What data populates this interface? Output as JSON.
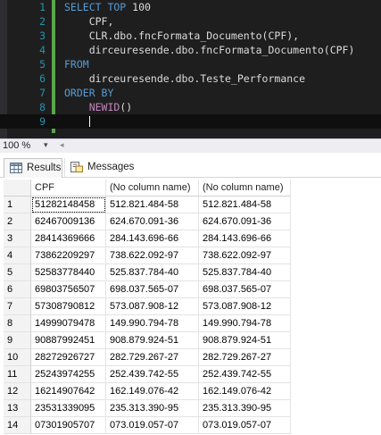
{
  "editor": {
    "lines": [
      {
        "num": "1",
        "parts": [
          {
            "t": "SELECT TOP ",
            "c": "kw"
          },
          {
            "t": "100",
            "c": ""
          }
        ]
      },
      {
        "num": "2",
        "parts": [
          {
            "t": "    CPF,",
            "c": ""
          }
        ]
      },
      {
        "num": "3",
        "parts": [
          {
            "t": "    CLR.dbo.fncFormata_Documento(CPF),",
            "c": ""
          }
        ]
      },
      {
        "num": "4",
        "parts": [
          {
            "t": "    dirceuresende.dbo.fncFormata_Documento(CPF)",
            "c": ""
          }
        ]
      },
      {
        "num": "5",
        "parts": [
          {
            "t": "FROM",
            "c": "kw"
          }
        ]
      },
      {
        "num": "6",
        "parts": [
          {
            "t": "    dirceuresende.dbo.Teste_Performance",
            "c": ""
          }
        ]
      },
      {
        "num": "7",
        "parts": [
          {
            "t": "ORDER BY",
            "c": "kw"
          }
        ]
      },
      {
        "num": "8",
        "parts": [
          {
            "t": "    ",
            "c": ""
          },
          {
            "t": "NEWID",
            "c": "fn"
          },
          {
            "t": "()",
            "c": ""
          }
        ]
      },
      {
        "num": "9",
        "parts": [
          {
            "t": "",
            "c": ""
          }
        ]
      }
    ]
  },
  "status": {
    "zoom": "100 %",
    "zoom_arrow": "▾",
    "scroll_arrow": "◂"
  },
  "tabs": {
    "results_label": "Results",
    "messages_label": "Messages"
  },
  "grid": {
    "columns": [
      "CPF",
      "(No column name)",
      "(No column name)"
    ],
    "rows": [
      [
        "1",
        "51282148458",
        "512.821.484-58",
        "512.821.484-58"
      ],
      [
        "2",
        "62467009136",
        "624.670.091-36",
        "624.670.091-36"
      ],
      [
        "3",
        "28414369666",
        "284.143.696-66",
        "284.143.696-66"
      ],
      [
        "4",
        "73862209297",
        "738.622.092-97",
        "738.622.092-97"
      ],
      [
        "5",
        "52583778440",
        "525.837.784-40",
        "525.837.784-40"
      ],
      [
        "6",
        "69803756507",
        "698.037.565-07",
        "698.037.565-07"
      ],
      [
        "7",
        "57308790812",
        "573.087.908-12",
        "573.087.908-12"
      ],
      [
        "8",
        "14999079478",
        "149.990.794-78",
        "149.990.794-78"
      ],
      [
        "9",
        "90887992451",
        "908.879.924-51",
        "908.879.924-51"
      ],
      [
        "10",
        "28272926727",
        "282.729.267-27",
        "282.729.267-27"
      ],
      [
        "11",
        "25243974255",
        "252.439.742-55",
        "252.439.742-55"
      ],
      [
        "12",
        "16214907642",
        "162.149.076-42",
        "162.149.076-42"
      ],
      [
        "13",
        "23531339095",
        "235.313.390-95",
        "235.313.390-95"
      ],
      [
        "14",
        "07301905707",
        "073.019.057-07",
        "073.019.057-07"
      ]
    ]
  },
  "colors": {
    "editor_bg": "#1e1e1e",
    "keyword": "#569cd6",
    "function": "#c586c0",
    "line_number": "#2b91af",
    "change_bar": "#57a64a"
  },
  "icons": {
    "results_tab": "grid-icon",
    "messages_tab": "messages-icon"
  }
}
